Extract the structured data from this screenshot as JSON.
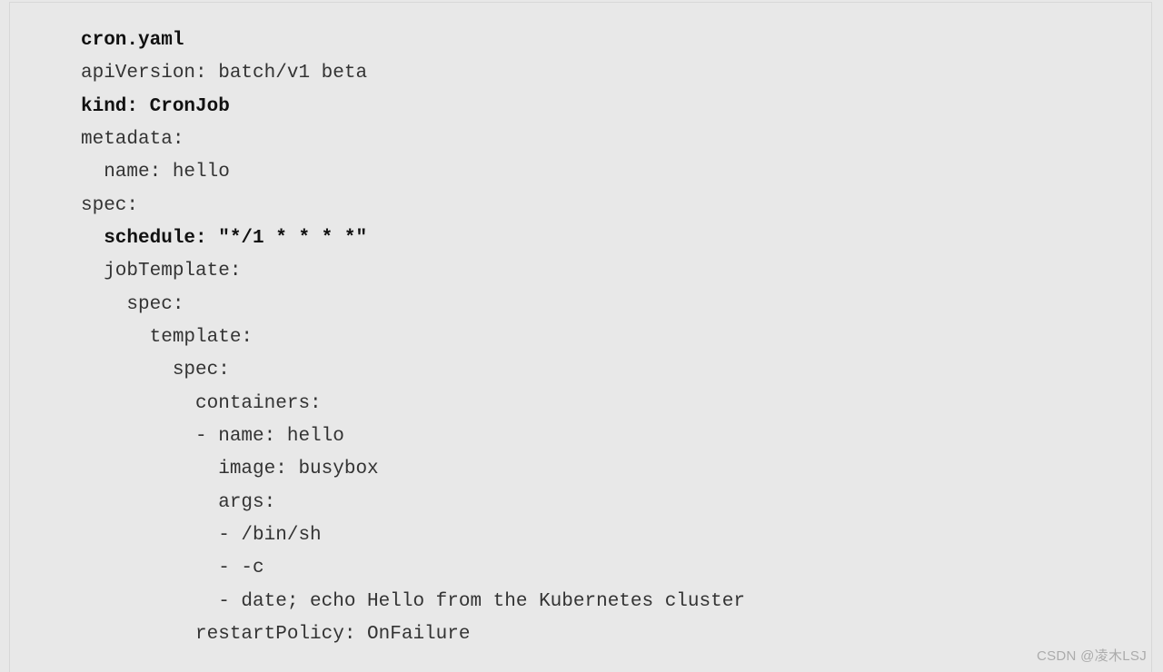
{
  "code": {
    "l01": "cron.yaml",
    "l02": "apiVersion: batch/v1 beta",
    "l03": "kind: CronJob",
    "l04": "metadata:",
    "l05": "  name: hello",
    "l06": "spec:",
    "l07": "  schedule: \"*/1 * * * *\"",
    "l08": "  jobTemplate:",
    "l09": "    spec:",
    "l10": "      template:",
    "l11": "        spec:",
    "l12": "          containers:",
    "l13": "          - name: hello",
    "l14": "            image: busybox",
    "l15": "            args:",
    "l16": "            - /bin/sh",
    "l17": "            - -c",
    "l18": "            - date; echo Hello from the Kubernetes cluster",
    "l19": "          restartPolicy: OnFailure"
  },
  "watermark": "CSDN @凌木LSJ"
}
